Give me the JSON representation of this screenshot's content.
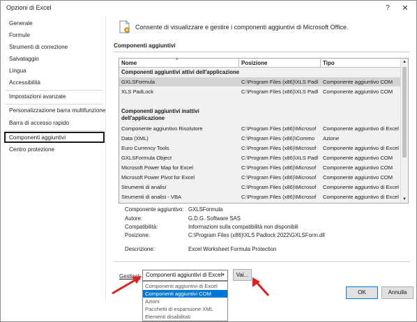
{
  "window": {
    "title": "Opzioni di Excel",
    "help": "?",
    "close": "✕"
  },
  "sidebar": {
    "items": [
      {
        "label": "Generale"
      },
      {
        "label": "Formule"
      },
      {
        "label": "Strumenti di correzione"
      },
      {
        "label": "Salvataggio"
      },
      {
        "label": "Lingua"
      },
      {
        "label": "Accessibilità"
      },
      {
        "label": "Impostazioni avanzate"
      },
      {
        "label": "Personalizzazione barra multifunzione"
      },
      {
        "label": "Barra di accesso rapido"
      },
      {
        "label": "Componenti aggiuntivi",
        "selected": true
      },
      {
        "label": "Centro protezione"
      }
    ]
  },
  "header": {
    "text": "Consente di visualizzare e gestire i componenti aggiuntivi di Microsoft Office.",
    "icon": "addins-gear-icon"
  },
  "section": {
    "title": "Componenti aggiuntivi"
  },
  "table": {
    "columns": [
      "Nome",
      "Posizione",
      "Tipo"
    ],
    "sort_indicator": "⌃",
    "active_group": "Componenti aggiuntivi attivi dell'applicazione",
    "active_rows": [
      {
        "name": "GXLSFormula",
        "location": "C:\\Program Files (x86)\\XLS Padl",
        "type": "Componente aggiuntivo COM",
        "selected": true
      },
      {
        "name": "XLS PadLock",
        "location": "C:\\Program Files (x86)\\XLS Padl",
        "type": "Componente aggiuntivo COM"
      }
    ],
    "inactive_group_line1": "Componenti aggiuntivi inattivi",
    "inactive_group_line2": "dell'applicazione",
    "inactive_rows": [
      {
        "name": "Componente aggiuntivo Risolutore",
        "location": "C:\\Program Files (x86)\\Microsof",
        "type": "Componente aggiuntivo di Excel"
      },
      {
        "name": "Data (XML)",
        "location": "C:\\Program Files (x86)\\Commo",
        "type": "Azione"
      },
      {
        "name": "Euro Currency Tools",
        "location": "C:\\Program Files (x86)\\Microsof",
        "type": "Componente aggiuntivo di Excel"
      },
      {
        "name": "GXLSFormula Object",
        "location": "C:\\Program Files (x86)\\XLS Padl",
        "type": "Componente aggiuntivo COM"
      },
      {
        "name": "Microsoft Power Map for Excel",
        "location": "C:\\Program Files (x86)\\Microsof",
        "type": "Componente aggiuntivo COM"
      },
      {
        "name": "Microsoft Power Pivot for Excel",
        "location": "C:\\Program Files (x86)\\Microsof",
        "type": "Componente aggiuntivo COM"
      },
      {
        "name": "Strumenti di analisi",
        "location": "C:\\Program Files (x86)\\Microsof",
        "type": "Componente aggiuntivo di Excel"
      },
      {
        "name": "Strumenti di analisi - VBA",
        "location": "C:\\Program Files (x86)\\Microsof",
        "type": "Componente aggiuntivo di Excel"
      }
    ]
  },
  "details": {
    "addin_label": "Componente aggiuntivo:",
    "addin_value": "GXLSFormula",
    "publisher_label": "Autore:",
    "publisher_value": "G.D.G. Software SAS",
    "compat_label": "Compatibilità:",
    "compat_value": "Informazioni sulla compatibilità non disponibili",
    "location_label": "Posizione:",
    "location_value": "C:\\Program Files (x86)\\XLS Padlock 2022\\GXLSForm.dll",
    "description_label": "Descrizione:",
    "description_value": "Excel Worksheet Formula Protection"
  },
  "manage": {
    "label": "Gestisci:",
    "selected": "Componenti aggiuntivi di Excel",
    "go_label": "Vai...",
    "options": [
      "Componenti aggiuntivi di Excel",
      "Componenti aggiuntivi COM",
      "Azioni",
      "Pacchetti di espansione XML",
      "Elementi disabilitati"
    ],
    "highlighted_index": 1
  },
  "buttons": {
    "ok": "OK",
    "cancel": "Annulla"
  },
  "colors": {
    "highlight": "#0078d7",
    "arrow": "#e02020",
    "selected_row": "#d4d4d4"
  }
}
